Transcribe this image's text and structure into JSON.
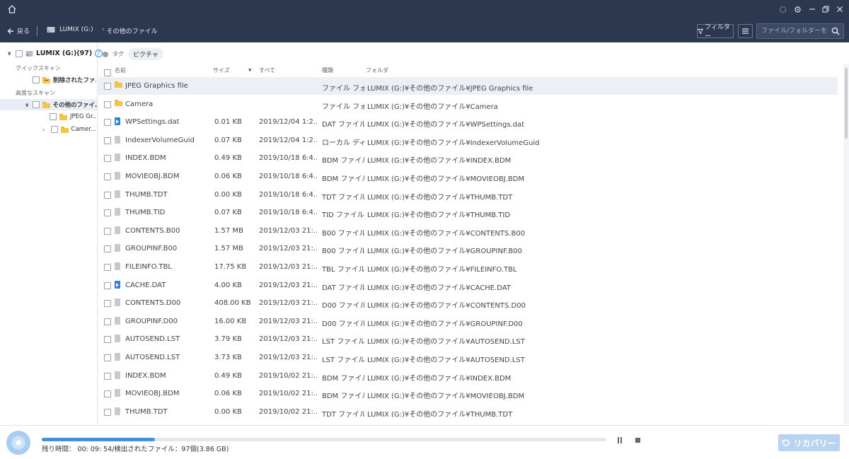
{
  "nav": {
    "back_label": "戻る",
    "drive_label": "LUMIX (G:)",
    "folder_label": "その他のファイル",
    "filter_label": "フィルター",
    "search_placeholder": "ファイル/フォルダーを検索"
  },
  "sidebar": {
    "root_label": "LUMIX (G:)(97)",
    "help_glyph": "?",
    "quick_scan_label": "クイックスキャン",
    "deleted_files_label": "削除されたファ...",
    "advanced_scan_label": "高度なスキャン",
    "other_files_label": "その他のファイ...",
    "child1_label": "JPEG Gr...",
    "child2_label": "Camer..."
  },
  "tag_bar": {
    "tag_label": "タグ",
    "pill_label": "ピクチャ"
  },
  "table": {
    "headers": {
      "name": "名前",
      "size": "サイズ",
      "date": "すべて",
      "type": "種類",
      "folder": "フォルダ"
    },
    "rows": [
      {
        "icon": "folder",
        "name": "JPEG Graphics file",
        "size": "",
        "date": "",
        "type": "ファイル フォ...",
        "folder": "LUMIX (G:)¥その他のファイル¥JPEG Graphics file"
      },
      {
        "icon": "folder",
        "name": "Camera",
        "size": "",
        "date": "",
        "type": "ファイル フォ...",
        "folder": "LUMIX (G:)¥その他のファイル¥Camera"
      },
      {
        "icon": "media",
        "name": "WPSettings.dat",
        "size": "0.01 KB",
        "date": "2019/12/04 1:2...",
        "type": "DAT ファイル",
        "folder": "LUMIX (G:)¥その他のファイル¥WPSettings.dat"
      },
      {
        "icon": "file",
        "name": "IndexerVolumeGuid",
        "size": "0.07 KB",
        "date": "2019/12/04 1:2...",
        "type": "ローカル ディスク",
        "folder": "LUMIX (G:)¥その他のファイル¥IndexerVolumeGuid"
      },
      {
        "icon": "file",
        "name": "INDEX.BDM",
        "size": "0.49 KB",
        "date": "2019/10/18 6:4...",
        "type": "BDM ファイル",
        "folder": "LUMIX (G:)¥その他のファイル¥INDEX.BDM"
      },
      {
        "icon": "file",
        "name": "MOVIEOBJ.BDM",
        "size": "0.06 KB",
        "date": "2019/10/18 6:4...",
        "type": "BDM ファイル",
        "folder": "LUMIX (G:)¥その他のファイル¥MOVIEOBJ.BDM"
      },
      {
        "icon": "file",
        "name": "THUMB.TDT",
        "size": "0.00 KB",
        "date": "2019/10/18 6:4...",
        "type": "TDT ファイル",
        "folder": "LUMIX (G:)¥その他のファイル¥THUMB.TDT"
      },
      {
        "icon": "file",
        "name": "THUMB.TID",
        "size": "0.07 KB",
        "date": "2019/10/18 6:4...",
        "type": "TID ファイル",
        "folder": "LUMIX (G:)¥その他のファイル¥THUMB.TID"
      },
      {
        "icon": "file",
        "name": "CONTENTS.B00",
        "size": "1.57 MB",
        "date": "2019/12/03 21:...",
        "type": "B00 ファイル",
        "folder": "LUMIX (G:)¥その他のファイル¥CONTENTS.B00"
      },
      {
        "icon": "file",
        "name": "GROUPINF.B00",
        "size": "1.57 MB",
        "date": "2019/12/03 21:...",
        "type": "B00 ファイル",
        "folder": "LUMIX (G:)¥その他のファイル¥GROUPINF.B00"
      },
      {
        "icon": "file",
        "name": "FILEINFO.TBL",
        "size": "17.75 KB",
        "date": "2019/12/03 21:...",
        "type": "TBL ファイル",
        "folder": "LUMIX (G:)¥その他のファイル¥FILEINFO.TBL"
      },
      {
        "icon": "media",
        "name": "CACHE.DAT",
        "size": "4.00 KB",
        "date": "2019/12/03 21:...",
        "type": "DAT ファイル",
        "folder": "LUMIX (G:)¥その他のファイル¥CACHE.DAT"
      },
      {
        "icon": "file",
        "name": "CONTENTS.D00",
        "size": "408.00 KB",
        "date": "2019/12/03 21:...",
        "type": "D00 ファイル",
        "folder": "LUMIX (G:)¥その他のファイル¥CONTENTS.D00"
      },
      {
        "icon": "file",
        "name": "GROUPINF.D00",
        "size": "16.00 KB",
        "date": "2019/12/03 21:...",
        "type": "D00 ファイル",
        "folder": "LUMIX (G:)¥その他のファイル¥GROUPINF.D00"
      },
      {
        "icon": "file",
        "name": "AUTOSEND.LST",
        "size": "3.79 KB",
        "date": "2019/12/03 21:...",
        "type": "LST ファイル",
        "folder": "LUMIX (G:)¥その他のファイル¥AUTOSEND.LST"
      },
      {
        "icon": "file",
        "name": "AUTOSEND.LST",
        "size": "3.73 KB",
        "date": "2019/12/03 21:...",
        "type": "LST ファイル",
        "folder": "LUMIX (G:)¥その他のファイル¥AUTOSEND.LST"
      },
      {
        "icon": "file",
        "name": "INDEX.BDM",
        "size": "0.49 KB",
        "date": "2019/10/02 21:...",
        "type": "BDM ファイル",
        "folder": "LUMIX (G:)¥その他のファイル¥INDEX.BDM"
      },
      {
        "icon": "file",
        "name": "MOVIEOBJ.BDM",
        "size": "0.06 KB",
        "date": "2019/10/02 21:...",
        "type": "BDM ファイル",
        "folder": "LUMIX (G:)¥その他のファイル¥MOVIEOBJ.BDM"
      },
      {
        "icon": "file",
        "name": "THUMB.TDT",
        "size": "0.00 KB",
        "date": "2019/10/02 21:...",
        "type": "TDT ファイル",
        "folder": "LUMIX (G:)¥その他のファイル¥THUMB.TDT"
      }
    ]
  },
  "bottom": {
    "status_text": "残り時間： 00: 09: 54/検出されたファイル：97個(3.86 GB)",
    "progress_fraction": 0.2,
    "recover_label": "リカバリー"
  },
  "colors": {
    "titlebar": "#2c3850",
    "accent": "#4a90d9",
    "folder": "#f5c542",
    "row_highlight": "#eceff5",
    "recover_button": "#b9d4f0"
  }
}
